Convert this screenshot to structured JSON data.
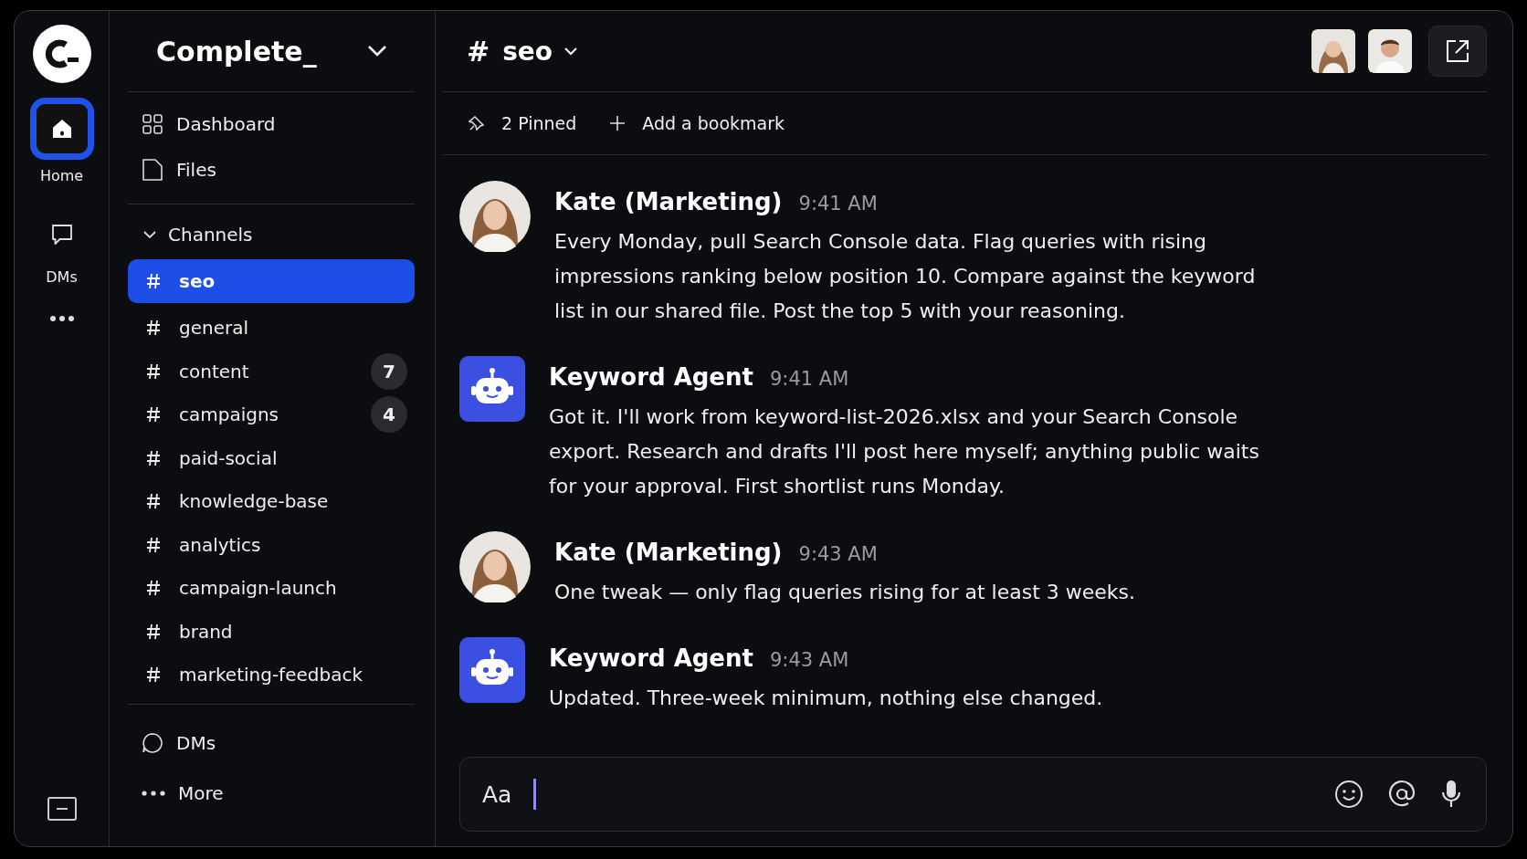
{
  "workspace": {
    "name": "Complete_"
  },
  "rail": [
    {
      "kind": "home",
      "label": "Home",
      "selected": true
    },
    {
      "kind": "dms",
      "label": "DMs",
      "selected": false
    },
    {
      "kind": "more",
      "selected": false
    }
  ],
  "sidebar": {
    "nav": [
      {
        "kind": "dashboard",
        "label": "Dashboard"
      },
      {
        "kind": "files",
        "label": "Files"
      }
    ],
    "section": {
      "label": "Channels",
      "expanded": true
    },
    "channels": [
      {
        "name": "seo",
        "selected": true
      },
      {
        "name": "general",
        "selected": false
      },
      {
        "name": "content",
        "selected": false,
        "badge": "7"
      },
      {
        "name": "campaigns",
        "selected": false,
        "badge": "4"
      },
      {
        "name": "paid-social",
        "selected": false
      },
      {
        "name": "knowledge-base",
        "selected": false
      },
      {
        "name": "analytics",
        "selected": false
      },
      {
        "name": "campaign-launch",
        "selected": false
      },
      {
        "name": "brand",
        "selected": false
      },
      {
        "name": "marketing-feedback",
        "selected": false
      }
    ],
    "footer": [
      {
        "kind": "dms",
        "label": "DMs"
      },
      {
        "kind": "more",
        "label": "More"
      }
    ]
  },
  "header": {
    "hash": "#",
    "channel": "seo",
    "pinned": "2 Pinned",
    "bookmark": "Add a bookmark"
  },
  "messages": [
    {
      "kind": "person",
      "author": "Kate (Marketing)",
      "time": "9:41 AM",
      "text": "Every Monday, pull Search Console data. Flag queries with rising impressions ranking below position 10. Compare against the keyword list in our shared file. Post the top 5 with your reasoning."
    },
    {
      "kind": "bot",
      "author": "Keyword Agent",
      "time": "9:41 AM",
      "text": "Got it. I'll work from keyword-list-2026.xlsx and your Search Console export. Research and drafts I'll post here myself; anything public waits for your approval. First shortlist runs Monday."
    },
    {
      "kind": "person",
      "author": "Kate (Marketing)",
      "time": "9:43 AM",
      "text": "One tweak — only flag queries rising for at least 3 weeks."
    },
    {
      "kind": "bot",
      "author": "Keyword Agent",
      "time": "9:43 AM",
      "text": "Updated. Three-week minimum, nothing else changed."
    }
  ],
  "composer": {
    "placeholder": "Aa"
  }
}
